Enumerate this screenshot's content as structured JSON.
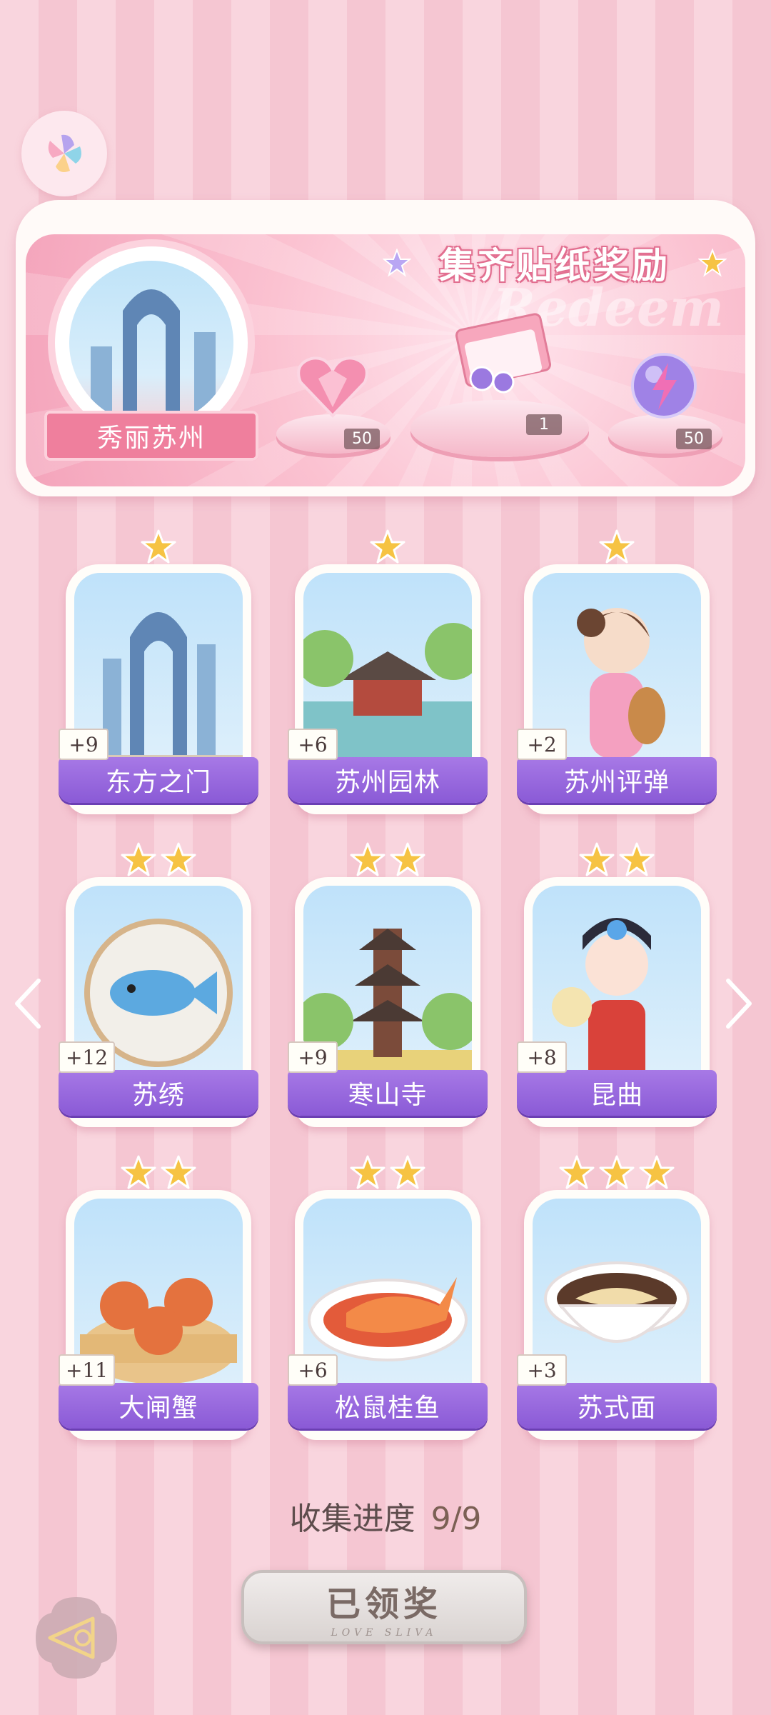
{
  "banner": {
    "title": "集齐贴纸奖励",
    "watermark": "Redeem",
    "city": "秀丽苏州",
    "rewards": [
      {
        "name": "heart-gem",
        "qty": "50"
      },
      {
        "name": "gift-box",
        "qty": "1"
      },
      {
        "name": "energy-orb",
        "qty": "50"
      }
    ]
  },
  "cards": [
    {
      "label": "东方之门",
      "badge": "+9",
      "stars": 1
    },
    {
      "label": "苏州园林",
      "badge": "+6",
      "stars": 1
    },
    {
      "label": "苏州评弹",
      "badge": "+2",
      "stars": 1
    },
    {
      "label": "苏绣",
      "badge": "+12",
      "stars": 2
    },
    {
      "label": "寒山寺",
      "badge": "+9",
      "stars": 2
    },
    {
      "label": "昆曲",
      "badge": "+8",
      "stars": 2
    },
    {
      "label": "大闸蟹",
      "badge": "+11",
      "stars": 2
    },
    {
      "label": "松鼠桂鱼",
      "badge": "+6",
      "stars": 2
    },
    {
      "label": "苏式面",
      "badge": "+3",
      "stars": 3
    }
  ],
  "progress": {
    "label": "收集进度",
    "value": "9/9"
  },
  "claim": {
    "label": "已领奖",
    "sub": "LOVE SLIVA"
  },
  "colors": {
    "accent": "#ef7f9d",
    "label_purple": "#8a5ad6",
    "star": "#f6c343"
  }
}
